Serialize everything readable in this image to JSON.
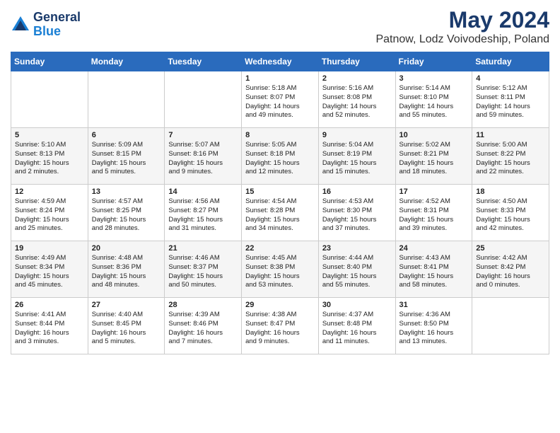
{
  "header": {
    "logo_general": "General",
    "logo_blue": "Blue",
    "month_title": "May 2024",
    "location": "Patnow, Lodz Voivodeship, Poland"
  },
  "weekdays": [
    "Sunday",
    "Monday",
    "Tuesday",
    "Wednesday",
    "Thursday",
    "Friday",
    "Saturday"
  ],
  "weeks": [
    [
      {
        "day": "",
        "info": ""
      },
      {
        "day": "",
        "info": ""
      },
      {
        "day": "",
        "info": ""
      },
      {
        "day": "1",
        "info": "Sunrise: 5:18 AM\nSunset: 8:07 PM\nDaylight: 14 hours\nand 49 minutes."
      },
      {
        "day": "2",
        "info": "Sunrise: 5:16 AM\nSunset: 8:08 PM\nDaylight: 14 hours\nand 52 minutes."
      },
      {
        "day": "3",
        "info": "Sunrise: 5:14 AM\nSunset: 8:10 PM\nDaylight: 14 hours\nand 55 minutes."
      },
      {
        "day": "4",
        "info": "Sunrise: 5:12 AM\nSunset: 8:11 PM\nDaylight: 14 hours\nand 59 minutes."
      }
    ],
    [
      {
        "day": "5",
        "info": "Sunrise: 5:10 AM\nSunset: 8:13 PM\nDaylight: 15 hours\nand 2 minutes."
      },
      {
        "day": "6",
        "info": "Sunrise: 5:09 AM\nSunset: 8:15 PM\nDaylight: 15 hours\nand 5 minutes."
      },
      {
        "day": "7",
        "info": "Sunrise: 5:07 AM\nSunset: 8:16 PM\nDaylight: 15 hours\nand 9 minutes."
      },
      {
        "day": "8",
        "info": "Sunrise: 5:05 AM\nSunset: 8:18 PM\nDaylight: 15 hours\nand 12 minutes."
      },
      {
        "day": "9",
        "info": "Sunrise: 5:04 AM\nSunset: 8:19 PM\nDaylight: 15 hours\nand 15 minutes."
      },
      {
        "day": "10",
        "info": "Sunrise: 5:02 AM\nSunset: 8:21 PM\nDaylight: 15 hours\nand 18 minutes."
      },
      {
        "day": "11",
        "info": "Sunrise: 5:00 AM\nSunset: 8:22 PM\nDaylight: 15 hours\nand 22 minutes."
      }
    ],
    [
      {
        "day": "12",
        "info": "Sunrise: 4:59 AM\nSunset: 8:24 PM\nDaylight: 15 hours\nand 25 minutes."
      },
      {
        "day": "13",
        "info": "Sunrise: 4:57 AM\nSunset: 8:25 PM\nDaylight: 15 hours\nand 28 minutes."
      },
      {
        "day": "14",
        "info": "Sunrise: 4:56 AM\nSunset: 8:27 PM\nDaylight: 15 hours\nand 31 minutes."
      },
      {
        "day": "15",
        "info": "Sunrise: 4:54 AM\nSunset: 8:28 PM\nDaylight: 15 hours\nand 34 minutes."
      },
      {
        "day": "16",
        "info": "Sunrise: 4:53 AM\nSunset: 8:30 PM\nDaylight: 15 hours\nand 37 minutes."
      },
      {
        "day": "17",
        "info": "Sunrise: 4:52 AM\nSunset: 8:31 PM\nDaylight: 15 hours\nand 39 minutes."
      },
      {
        "day": "18",
        "info": "Sunrise: 4:50 AM\nSunset: 8:33 PM\nDaylight: 15 hours\nand 42 minutes."
      }
    ],
    [
      {
        "day": "19",
        "info": "Sunrise: 4:49 AM\nSunset: 8:34 PM\nDaylight: 15 hours\nand 45 minutes."
      },
      {
        "day": "20",
        "info": "Sunrise: 4:48 AM\nSunset: 8:36 PM\nDaylight: 15 hours\nand 48 minutes."
      },
      {
        "day": "21",
        "info": "Sunrise: 4:46 AM\nSunset: 8:37 PM\nDaylight: 15 hours\nand 50 minutes."
      },
      {
        "day": "22",
        "info": "Sunrise: 4:45 AM\nSunset: 8:38 PM\nDaylight: 15 hours\nand 53 minutes."
      },
      {
        "day": "23",
        "info": "Sunrise: 4:44 AM\nSunset: 8:40 PM\nDaylight: 15 hours\nand 55 minutes."
      },
      {
        "day": "24",
        "info": "Sunrise: 4:43 AM\nSunset: 8:41 PM\nDaylight: 15 hours\nand 58 minutes."
      },
      {
        "day": "25",
        "info": "Sunrise: 4:42 AM\nSunset: 8:42 PM\nDaylight: 16 hours\nand 0 minutes."
      }
    ],
    [
      {
        "day": "26",
        "info": "Sunrise: 4:41 AM\nSunset: 8:44 PM\nDaylight: 16 hours\nand 3 minutes."
      },
      {
        "day": "27",
        "info": "Sunrise: 4:40 AM\nSunset: 8:45 PM\nDaylight: 16 hours\nand 5 minutes."
      },
      {
        "day": "28",
        "info": "Sunrise: 4:39 AM\nSunset: 8:46 PM\nDaylight: 16 hours\nand 7 minutes."
      },
      {
        "day": "29",
        "info": "Sunrise: 4:38 AM\nSunset: 8:47 PM\nDaylight: 16 hours\nand 9 minutes."
      },
      {
        "day": "30",
        "info": "Sunrise: 4:37 AM\nSunset: 8:48 PM\nDaylight: 16 hours\nand 11 minutes."
      },
      {
        "day": "31",
        "info": "Sunrise: 4:36 AM\nSunset: 8:50 PM\nDaylight: 16 hours\nand 13 minutes."
      },
      {
        "day": "",
        "info": ""
      }
    ]
  ]
}
